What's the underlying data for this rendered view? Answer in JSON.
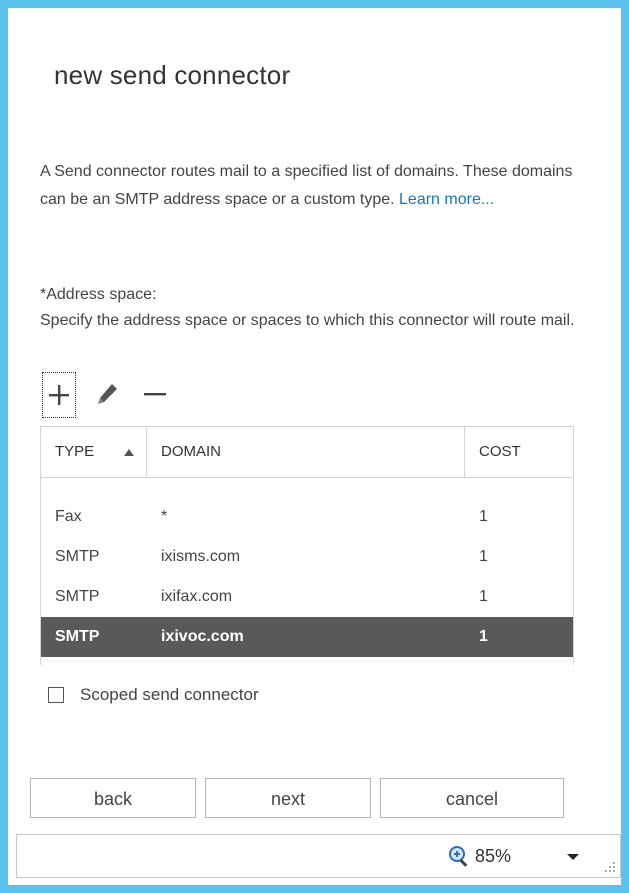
{
  "dialog": {
    "title": "new send connector",
    "description": "A Send connector routes mail to a specified list of domains. These domains can be an SMTP address space or a custom type.",
    "learn_more": "Learn more..."
  },
  "address_space": {
    "label": "*Address space:",
    "help": "Specify the address space or spaces to which this connector will route mail."
  },
  "toolbar": {
    "add_icon": "plus-icon",
    "edit_icon": "pencil-icon",
    "remove_icon": "minus-icon"
  },
  "table": {
    "columns": [
      "TYPE",
      "DOMAIN",
      "COST"
    ],
    "rows": [
      {
        "type": "Fax",
        "domain": "*",
        "cost": "1"
      },
      {
        "type": "SMTP",
        "domain": "ixisms.com",
        "cost": "1"
      },
      {
        "type": "SMTP",
        "domain": "ixifax.com",
        "cost": "1"
      },
      {
        "type": "SMTP",
        "domain": "ixivoc.com",
        "cost": "1"
      }
    ],
    "selected_row": 3
  },
  "scoped": {
    "label": "Scoped send connector",
    "checked": false
  },
  "buttons": {
    "back": "back",
    "next": "next",
    "cancel": "cancel"
  },
  "statusbar": {
    "zoom": "85%"
  },
  "colors": {
    "frame": "#5bc4ee",
    "link": "#1a73c4",
    "selected_row": "#595959"
  }
}
